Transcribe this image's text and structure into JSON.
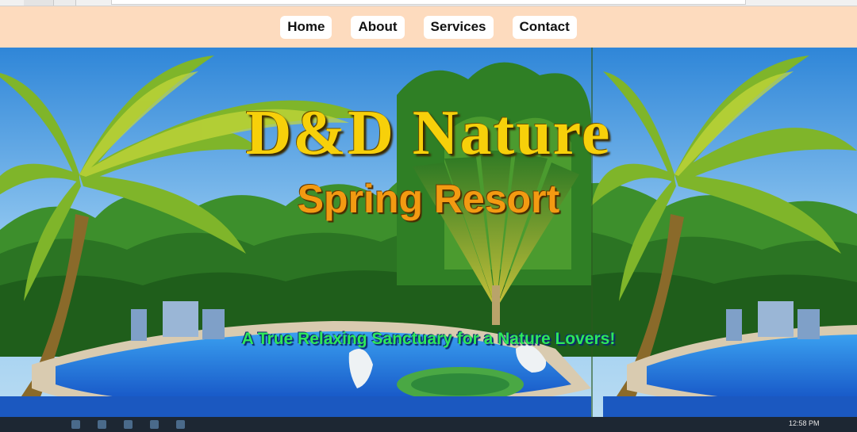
{
  "nav": {
    "items": [
      {
        "label": "Home"
      },
      {
        "label": "About"
      },
      {
        "label": "Services"
      },
      {
        "label": "Contact"
      }
    ]
  },
  "hero": {
    "title": "D&D Nature",
    "subtitle": "Spring Resort",
    "tagline": "A True Relaxing Sanctuary for a Nature Lovers!"
  },
  "taskbar": {
    "clock": "12:58 PM"
  },
  "colors": {
    "navbar_bg": "#fddbbe",
    "title": "#f7d00a",
    "subtitle": "#f39a12",
    "tagline": "#2ee85a",
    "pool": "#1f73d8"
  }
}
